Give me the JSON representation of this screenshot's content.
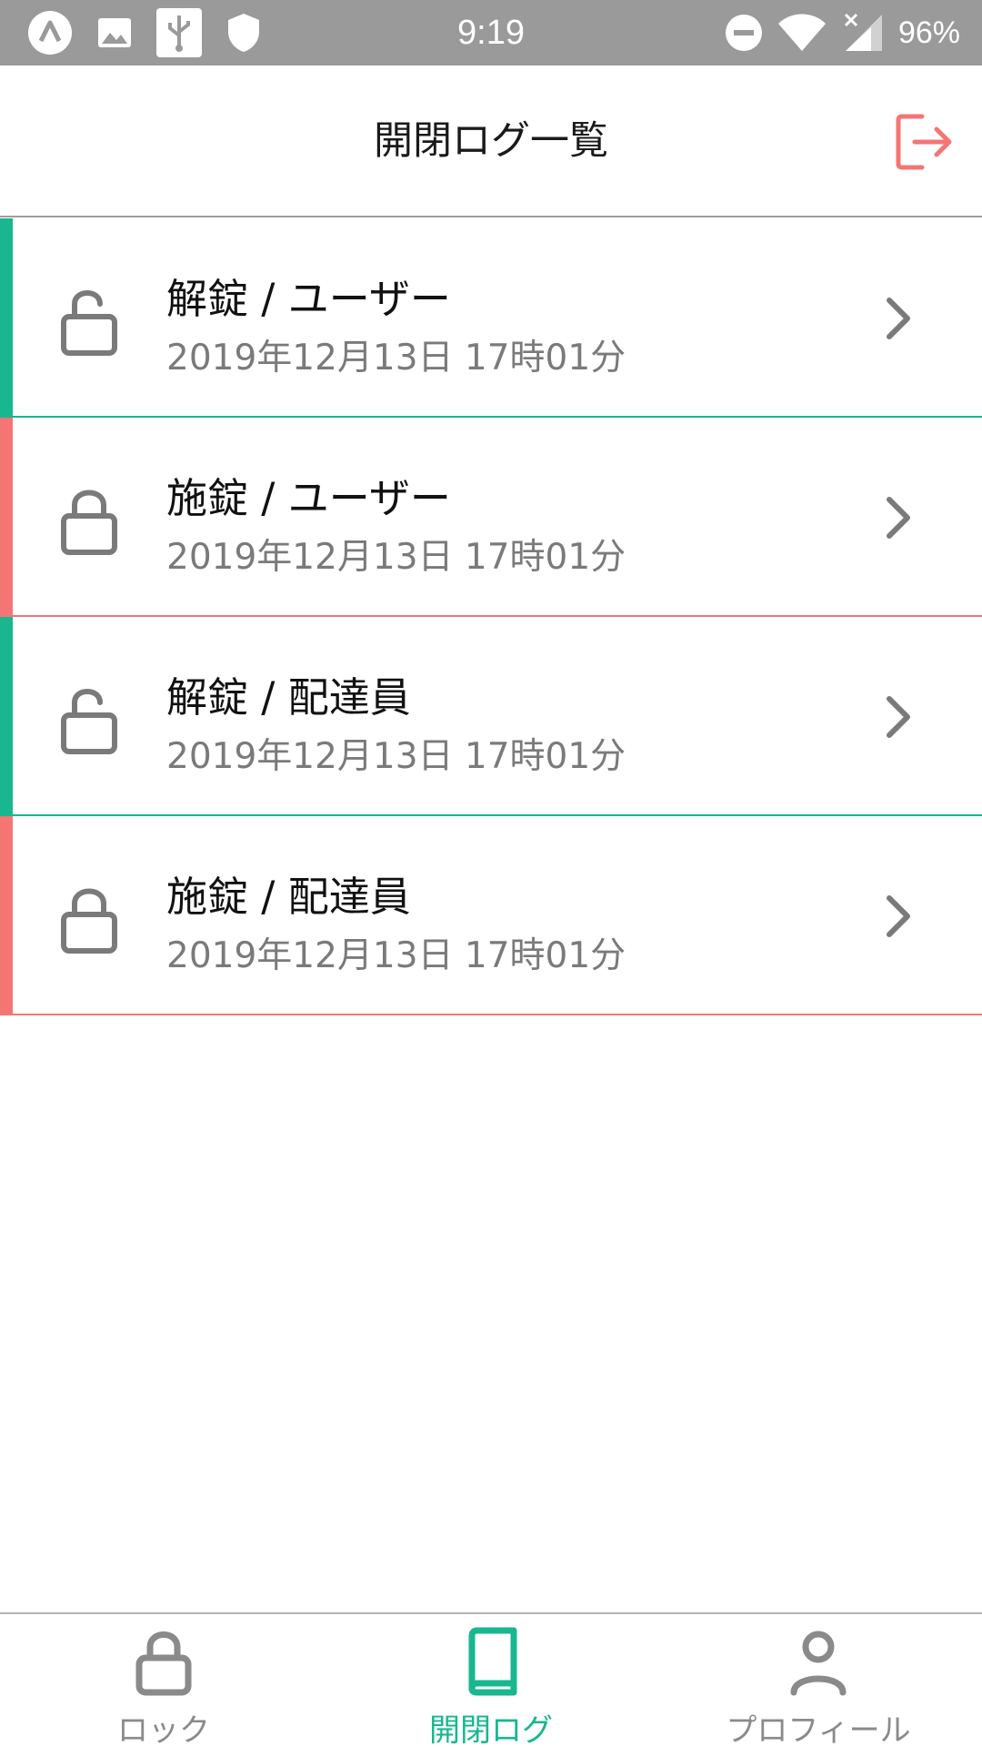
{
  "status_bar": {
    "time": "9:19",
    "battery": "96%",
    "icons": [
      "a-icon",
      "image-icon",
      "usb-icon",
      "shield-icon",
      "dnd-icon",
      "wifi-icon",
      "signal-icon"
    ]
  },
  "header": {
    "title": "開閉ログ一覧",
    "logout_icon": "logout-icon"
  },
  "colors": {
    "unlock": "#18b78f",
    "lock": "#f57575",
    "logout": "#f57575",
    "active_nav": "#18b78f",
    "inactive_nav": "#8a8a8a"
  },
  "logs": [
    {
      "state": "unlock",
      "title": "解錠 / ユーザー",
      "time": "2019年12月13日 17時01分"
    },
    {
      "state": "lock",
      "title": "施錠 / ユーザー",
      "time": "2019年12月13日 17時01分"
    },
    {
      "state": "unlock",
      "title": "解錠 / 配達員",
      "time": "2019年12月13日 17時01分"
    },
    {
      "state": "lock",
      "title": "施錠 / 配達員",
      "time": "2019年12月13日 17時01分"
    }
  ],
  "bottom_nav": {
    "items": [
      {
        "label": "ロック",
        "icon": "lock-icon",
        "active": false
      },
      {
        "label": "開閉ログ",
        "icon": "book-icon",
        "active": true
      },
      {
        "label": "プロフィール",
        "icon": "person-icon",
        "active": false
      }
    ]
  }
}
